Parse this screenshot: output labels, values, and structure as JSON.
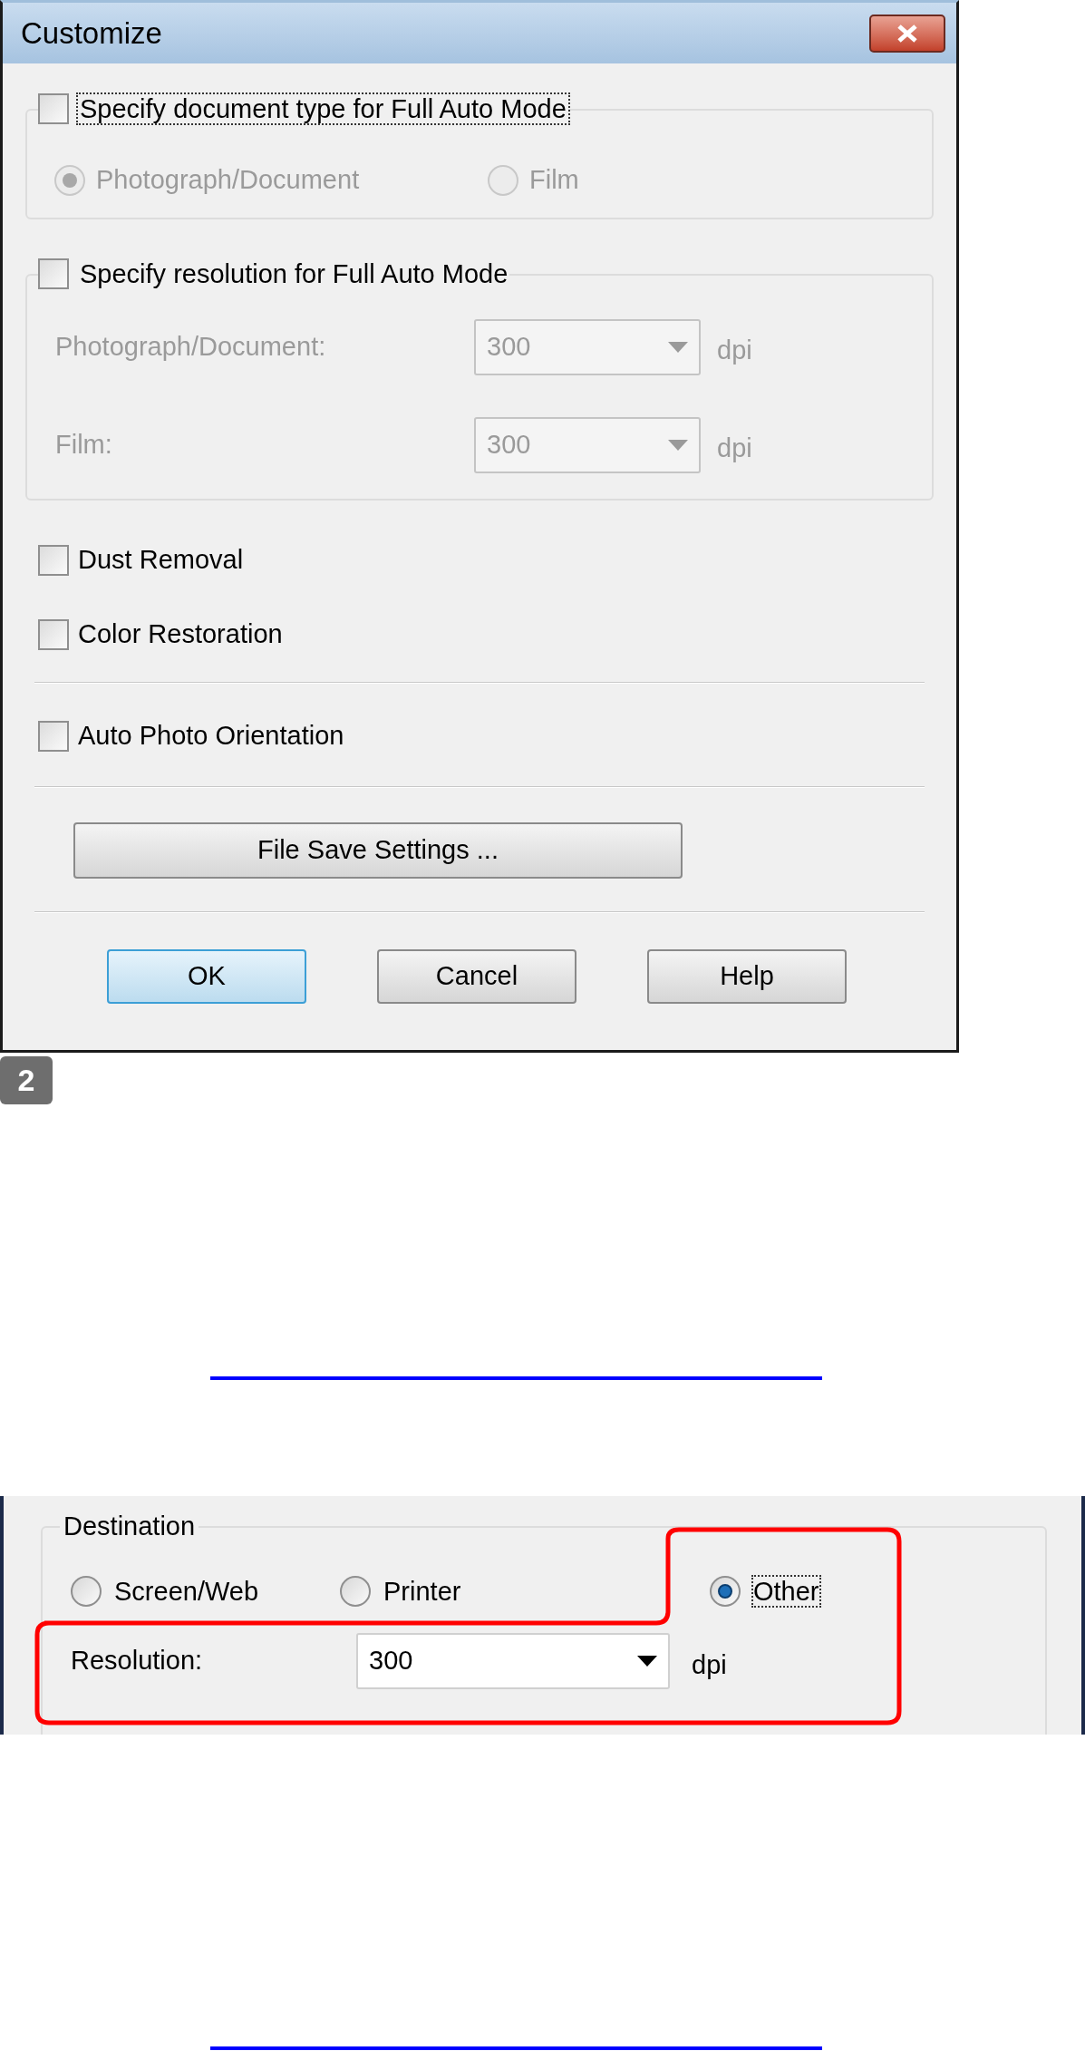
{
  "dialog": {
    "title": "Customize",
    "doc_type_group": {
      "label": "Specify document type for Full Auto Mode",
      "checked": false,
      "focused": true,
      "options": [
        {
          "label": "Photograph/Document",
          "selected": true,
          "disabled": true
        },
        {
          "label": "Film",
          "selected": false,
          "disabled": true
        }
      ]
    },
    "resolution_group": {
      "label": "Specify resolution for Full Auto Mode",
      "checked": false,
      "focused": false,
      "rows": [
        {
          "label": "Photograph/Document:",
          "value": "300",
          "unit": "dpi",
          "disabled": true
        },
        {
          "label": "Film:",
          "value": "300",
          "unit": "dpi",
          "disabled": true
        }
      ]
    },
    "options": [
      {
        "label": "Dust Removal",
        "checked": false
      },
      {
        "label": "Color Restoration",
        "checked": false
      }
    ],
    "orientation": {
      "label": "Auto Photo Orientation",
      "checked": false
    },
    "file_save_button": "File Save Settings ...",
    "buttons": [
      {
        "label": "OK",
        "default": true
      },
      {
        "label": "Cancel",
        "default": false
      },
      {
        "label": "Help",
        "default": false
      }
    ]
  },
  "step_badge": "2",
  "destination_panel": {
    "title": "Destination",
    "options": [
      {
        "label": "Screen/Web",
        "selected": false,
        "focused": false
      },
      {
        "label": "Printer",
        "selected": false,
        "focused": false
      },
      {
        "label": "Other",
        "selected": true,
        "focused": true
      }
    ],
    "resolution": {
      "label": "Resolution:",
      "value": "300",
      "unit": "dpi"
    }
  }
}
